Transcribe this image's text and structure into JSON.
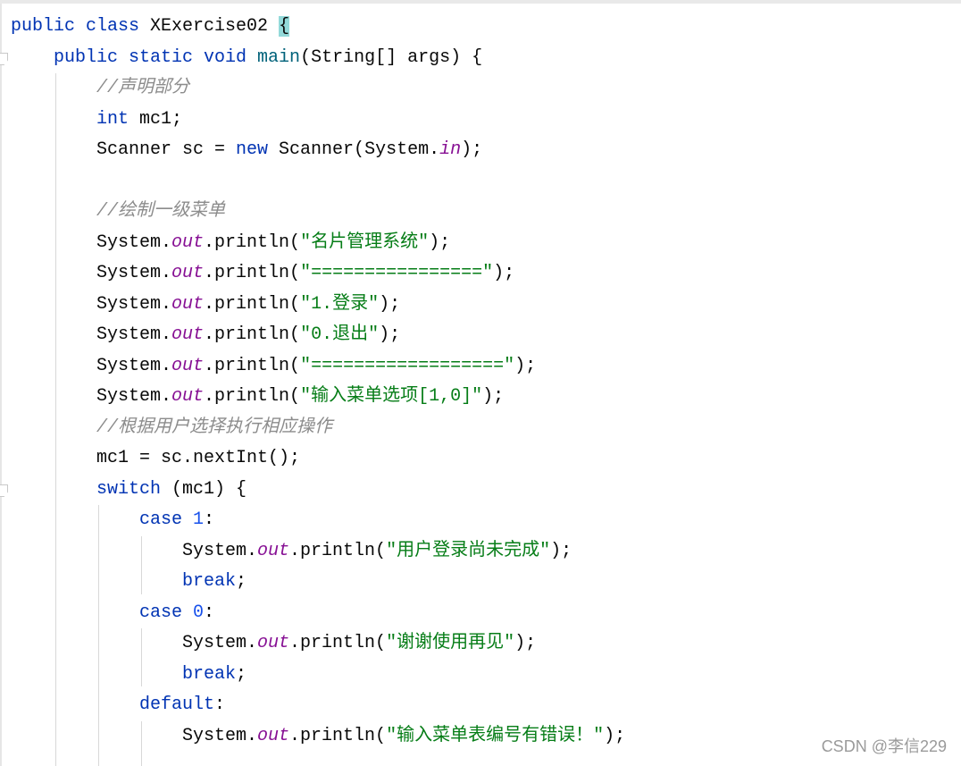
{
  "editor": {
    "colors": {
      "keyword": "#0033b3",
      "string": "#067d17",
      "comment": "#8c8c8c",
      "static_field": "#871094",
      "method_declaration": "#00627a",
      "number": "#1750eb",
      "brace_highlight": "#93d9d9"
    },
    "lines": [
      {
        "indent": 0,
        "tokens": [
          {
            "t": "public class ",
            "c": "kw"
          },
          {
            "t": "XExercise02 ",
            "c": "plain"
          },
          {
            "t": "{",
            "c": "plain brace-hl"
          }
        ]
      },
      {
        "indent": 1,
        "tokens": [
          {
            "t": "public static void ",
            "c": "kw"
          },
          {
            "t": "main",
            "c": "mdecl"
          },
          {
            "t": "(String[] args) {",
            "c": "plain"
          }
        ]
      },
      {
        "indent": 2,
        "tokens": [
          {
            "t": "//声明部分",
            "c": "cmt"
          }
        ]
      },
      {
        "indent": 2,
        "tokens": [
          {
            "t": "int ",
            "c": "kw"
          },
          {
            "t": "mc1;",
            "c": "plain"
          }
        ]
      },
      {
        "indent": 2,
        "tokens": [
          {
            "t": "Scanner sc = ",
            "c": "plain"
          },
          {
            "t": "new ",
            "c": "kw"
          },
          {
            "t": "Scanner(System.",
            "c": "plain"
          },
          {
            "t": "in",
            "c": "fld"
          },
          {
            "t": ");",
            "c": "plain"
          }
        ]
      },
      {
        "indent": 2,
        "tokens": []
      },
      {
        "indent": 2,
        "tokens": [
          {
            "t": "//绘制一级菜单",
            "c": "cmt"
          }
        ]
      },
      {
        "indent": 2,
        "tokens": [
          {
            "t": "System.",
            "c": "plain"
          },
          {
            "t": "out",
            "c": "fld"
          },
          {
            "t": ".println(",
            "c": "plain"
          },
          {
            "t": "\"名片管理系统\"",
            "c": "str"
          },
          {
            "t": ");",
            "c": "plain"
          }
        ]
      },
      {
        "indent": 2,
        "tokens": [
          {
            "t": "System.",
            "c": "plain"
          },
          {
            "t": "out",
            "c": "fld"
          },
          {
            "t": ".println(",
            "c": "plain"
          },
          {
            "t": "\"================\"",
            "c": "str"
          },
          {
            "t": ");",
            "c": "plain"
          }
        ]
      },
      {
        "indent": 2,
        "tokens": [
          {
            "t": "System.",
            "c": "plain"
          },
          {
            "t": "out",
            "c": "fld"
          },
          {
            "t": ".println(",
            "c": "plain"
          },
          {
            "t": "\"1.登录\"",
            "c": "str"
          },
          {
            "t": ");",
            "c": "plain"
          }
        ]
      },
      {
        "indent": 2,
        "tokens": [
          {
            "t": "System.",
            "c": "plain"
          },
          {
            "t": "out",
            "c": "fld"
          },
          {
            "t": ".println(",
            "c": "plain"
          },
          {
            "t": "\"0.退出\"",
            "c": "str"
          },
          {
            "t": ");",
            "c": "plain"
          }
        ]
      },
      {
        "indent": 2,
        "tokens": [
          {
            "t": "System.",
            "c": "plain"
          },
          {
            "t": "out",
            "c": "fld"
          },
          {
            "t": ".println(",
            "c": "plain"
          },
          {
            "t": "\"==================\"",
            "c": "str"
          },
          {
            "t": ");",
            "c": "plain"
          }
        ]
      },
      {
        "indent": 2,
        "tokens": [
          {
            "t": "System.",
            "c": "plain"
          },
          {
            "t": "out",
            "c": "fld"
          },
          {
            "t": ".println(",
            "c": "plain"
          },
          {
            "t": "\"输入菜单选项[1,0]\"",
            "c": "str"
          },
          {
            "t": ");",
            "c": "plain"
          }
        ]
      },
      {
        "indent": 2,
        "tokens": [
          {
            "t": "//根据用户选择执行相应操作",
            "c": "cmt"
          }
        ]
      },
      {
        "indent": 2,
        "tokens": [
          {
            "t": "mc1 = sc.nextInt();",
            "c": "plain"
          }
        ]
      },
      {
        "indent": 2,
        "tokens": [
          {
            "t": "switch ",
            "c": "kw"
          },
          {
            "t": "(mc1) {",
            "c": "plain"
          }
        ]
      },
      {
        "indent": 3,
        "tokens": [
          {
            "t": "case ",
            "c": "kw"
          },
          {
            "t": "1",
            "c": "num"
          },
          {
            "t": ":",
            "c": "plain"
          }
        ]
      },
      {
        "indent": 4,
        "tokens": [
          {
            "t": "System.",
            "c": "plain"
          },
          {
            "t": "out",
            "c": "fld"
          },
          {
            "t": ".println(",
            "c": "plain"
          },
          {
            "t": "\"用户登录尚未完成\"",
            "c": "str"
          },
          {
            "t": ");",
            "c": "plain"
          }
        ]
      },
      {
        "indent": 4,
        "tokens": [
          {
            "t": "break",
            "c": "kw"
          },
          {
            "t": ";",
            "c": "plain"
          }
        ]
      },
      {
        "indent": 3,
        "tokens": [
          {
            "t": "case ",
            "c": "kw"
          },
          {
            "t": "0",
            "c": "num"
          },
          {
            "t": ":",
            "c": "plain"
          }
        ]
      },
      {
        "indent": 4,
        "tokens": [
          {
            "t": "System.",
            "c": "plain"
          },
          {
            "t": "out",
            "c": "fld"
          },
          {
            "t": ".println(",
            "c": "plain"
          },
          {
            "t": "\"谢谢使用再见\"",
            "c": "str"
          },
          {
            "t": ");",
            "c": "plain"
          }
        ]
      },
      {
        "indent": 4,
        "tokens": [
          {
            "t": "break",
            "c": "kw"
          },
          {
            "t": ";",
            "c": "plain"
          }
        ]
      },
      {
        "indent": 3,
        "tokens": [
          {
            "t": "default",
            "c": "kw"
          },
          {
            "t": ":",
            "c": "plain"
          }
        ]
      },
      {
        "indent": 4,
        "tokens": [
          {
            "t": "System.",
            "c": "plain"
          },
          {
            "t": "out",
            "c": "fld"
          },
          {
            "t": ".println(",
            "c": "plain"
          },
          {
            "t": "\"输入菜单表编号有错误！\"",
            "c": "str"
          },
          {
            "t": ");",
            "c": "plain"
          }
        ]
      }
    ]
  },
  "watermark": "CSDN @李信229"
}
